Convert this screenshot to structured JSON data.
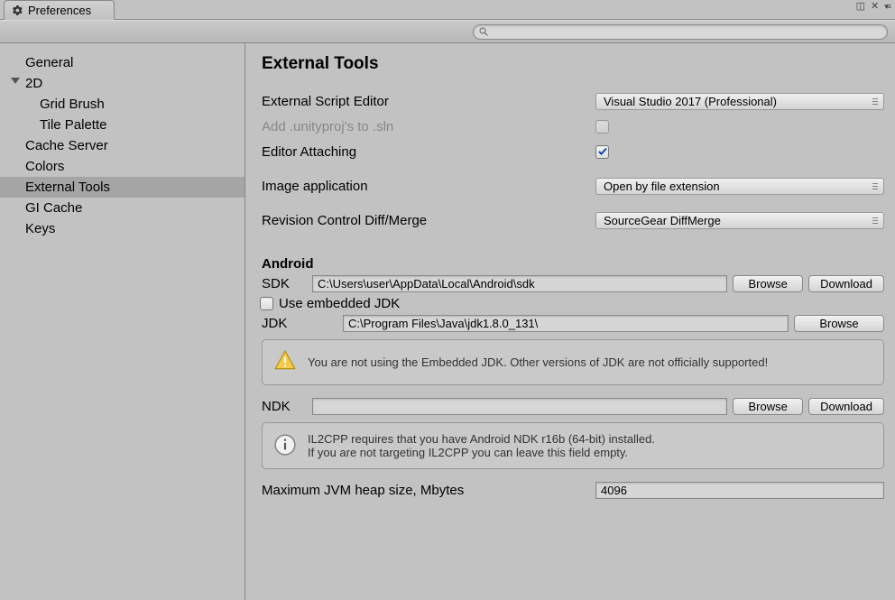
{
  "tab": {
    "title": "Preferences"
  },
  "search": {
    "placeholder": ""
  },
  "sidebar": {
    "items": [
      {
        "label": "General"
      },
      {
        "label": "2D"
      },
      {
        "label": "Grid Brush"
      },
      {
        "label": "Tile Palette"
      },
      {
        "label": "Cache Server"
      },
      {
        "label": "Colors"
      },
      {
        "label": "External Tools"
      },
      {
        "label": "GI Cache"
      },
      {
        "label": "Keys"
      }
    ]
  },
  "page": {
    "title": "External Tools",
    "externalScriptEditor": {
      "label": "External Script Editor",
      "value": "Visual Studio 2017 (Professional)"
    },
    "addUnityproj": {
      "label": "Add .unityproj's to .sln"
    },
    "editorAttaching": {
      "label": "Editor Attaching"
    },
    "imageApp": {
      "label": "Image application",
      "value": "Open by file extension"
    },
    "revisionControl": {
      "label": "Revision Control Diff/Merge",
      "value": "SourceGear DiffMerge"
    },
    "android": {
      "title": "Android",
      "sdk": {
        "label": "SDK",
        "value": "C:\\Users\\user\\AppData\\Local\\Android\\sdk",
        "browse": "Browse",
        "download": "Download"
      },
      "embeddedJdk": {
        "label": "Use embedded JDK"
      },
      "jdk": {
        "label": "JDK",
        "value": "C:\\Program Files\\Java\\jdk1.8.0_131\\",
        "browse": "Browse"
      },
      "jdkWarning": "You are not using the Embedded JDK. Other versions of JDK are not officially supported!",
      "ndk": {
        "label": "NDK",
        "value": "",
        "browse": "Browse",
        "download": "Download"
      },
      "ndkInfoLine1": "IL2CPP requires that you have Android NDK r16b (64-bit) installed.",
      "ndkInfoLine2": "If you are not targeting IL2CPP you can leave this field empty.",
      "heap": {
        "label": "Maximum JVM heap size, Mbytes",
        "value": "4096"
      }
    }
  }
}
